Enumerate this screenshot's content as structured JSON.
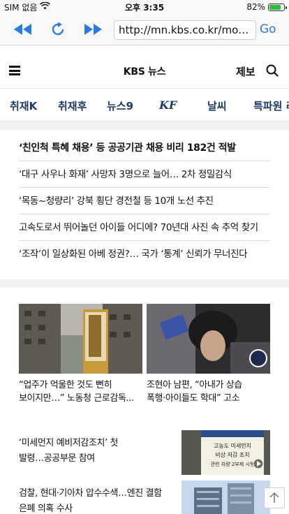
{
  "status_bar": {
    "carrier": "SIM 없음",
    "time": "오후 3:35",
    "battery": "82%",
    "battery_level": 0.82
  },
  "browser": {
    "url": "http://mn.kbs.co.kr/mobile/...",
    "go_label": "Go",
    "back_icon": "rewind-icon",
    "reload_icon": "reload-icon",
    "forward_icon": "fast-forward-icon"
  },
  "site": {
    "logo": "KBS 뉴스",
    "tip_label": "제보"
  },
  "categories": [
    "취재K",
    "취재후",
    "뉴스9",
    "KF",
    "날씨",
    "특파원 리"
  ],
  "headlines": [
    "‘친인척 특혜 채용’ 등 공공기관 채용 비리 182건 적발",
    "‘대구 사우나 화재’ 사망자 3명으로 늘어… 2차 정밀감식",
    "‘목동~청량리’ 강북 횡단 경전철 등 10개 노선 추진",
    "고속도로서 뛰어놀던 아이들 어디에? 70년대 사진 속 추억 찾기",
    "‘조작’이 일상화된 아베 정권?… 국가 ‘통계’ 신뢰가 무너진다"
  ],
  "photo_cards": [
    {
      "line1": "“업주가 억울한 것도 뻔히",
      "line2": "보이지만…” 노동청 근로감독..."
    },
    {
      "line1": "조현아 남편, “아내가 상습",
      "line2": "폭행·아이들도 학대” 고소"
    }
  ],
  "list_items": [
    {
      "line1": "‘미세먼지 예비저감조치’ 첫",
      "line2": "발령…공공부문 참여",
      "thumb_text": [
        "고농도 미세먼지",
        "비상 저감 조치",
        "관련 차량 2부제 시행"
      ]
    },
    {
      "line1": "검찰, 현대·기아차 압수수색…엔진 결함",
      "line2": "은폐 의혹 수사"
    }
  ],
  "colors": {
    "accent_blue": "#2a7ae0",
    "nav_text": "#1f3c66",
    "divider": "#f2f2f2"
  }
}
